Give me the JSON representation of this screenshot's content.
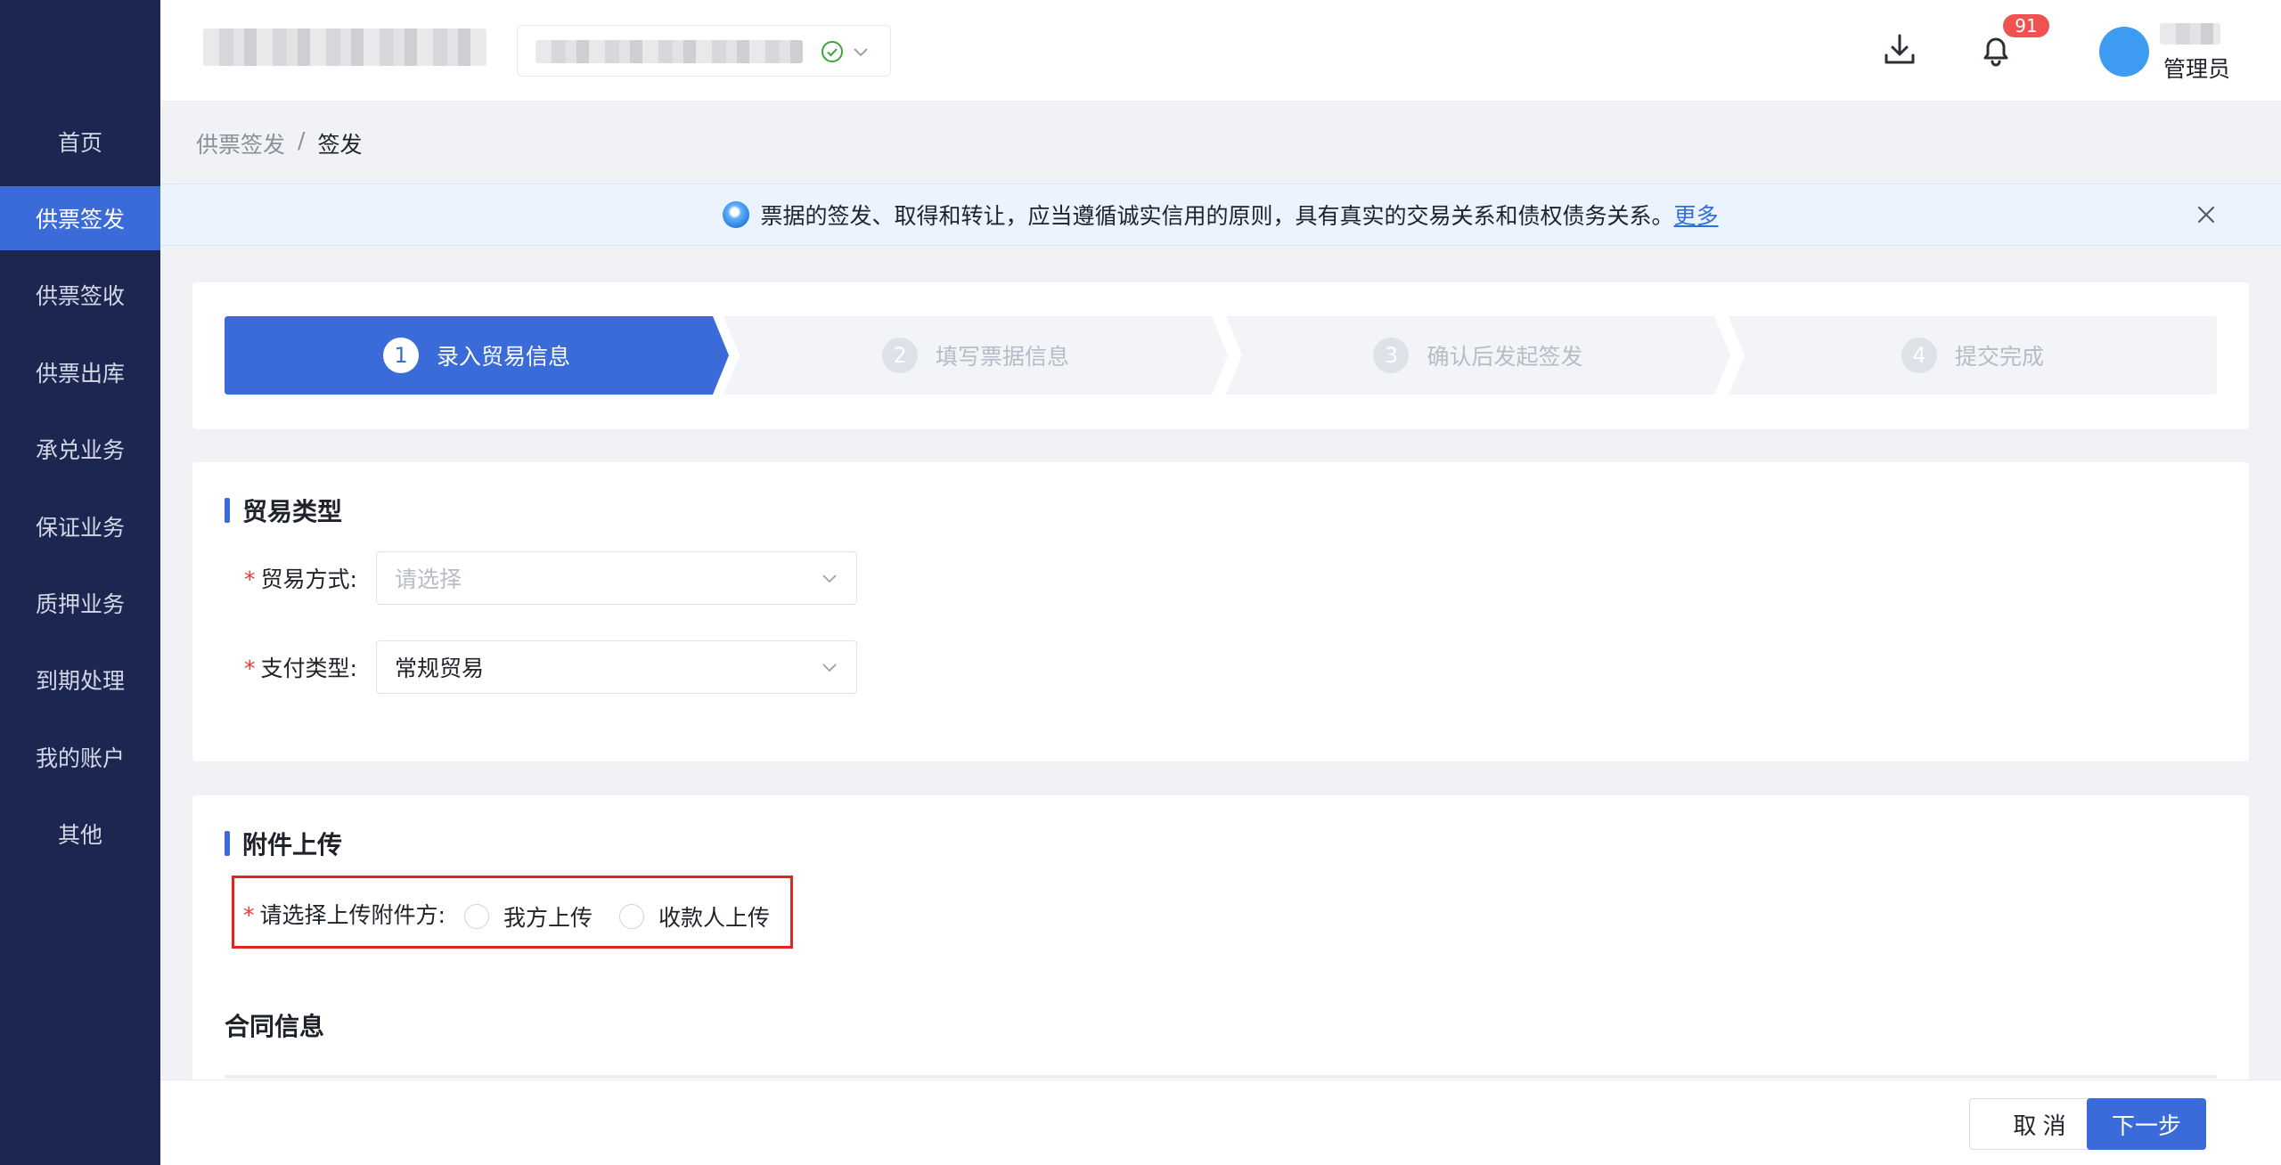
{
  "sidebar": {
    "items": [
      {
        "label": "首页",
        "active": false
      },
      {
        "label": "供票签发",
        "active": true
      },
      {
        "label": "供票签收",
        "active": false
      },
      {
        "label": "供票出库",
        "active": false
      },
      {
        "label": "承兑业务",
        "active": false
      },
      {
        "label": "保证业务",
        "active": false
      },
      {
        "label": "质押业务",
        "active": false
      },
      {
        "label": "到期处理",
        "active": false
      },
      {
        "label": "我的账户",
        "active": false
      },
      {
        "label": "其他",
        "active": false
      }
    ]
  },
  "header": {
    "notification_count": "91",
    "user_role": "管理员",
    "icons": [
      "download-icon",
      "bell-icon",
      "check-circle-icon",
      "chevron-down-icon"
    ]
  },
  "breadcrumb": {
    "parent": "供票签发",
    "separator": "/",
    "current": "签发"
  },
  "notice": {
    "text": "票据的签发、取得和转让，应当遵循诚实信用的原则，具有真实的交易关系和债权债务关系。",
    "link": "更多"
  },
  "steps": [
    {
      "num": "1",
      "label": "录入贸易信息",
      "active": true
    },
    {
      "num": "2",
      "label": "填写票据信息",
      "active": false
    },
    {
      "num": "3",
      "label": "确认后发起签发",
      "active": false
    },
    {
      "num": "4",
      "label": "提交完成",
      "active": false
    }
  ],
  "trade_section": {
    "title": "贸易类型",
    "trade_method_label": "贸易方式:",
    "trade_method_placeholder": "请选择",
    "payment_type_label": "支付类型:",
    "payment_type_value": "常规贸易",
    "required_mark": "*"
  },
  "attach_section": {
    "title": "附件上传",
    "uploader_label": "请选择上传附件方:",
    "option_self": "我方上传",
    "option_payee": "收款人上传",
    "contract_title": "合同信息"
  },
  "footer": {
    "cancel_label": "取 消",
    "next_label": "下一步"
  },
  "colors": {
    "sidebar_bg": "#1c2751",
    "accent": "#3a6bd8",
    "highlight_border": "#e3231d",
    "badge": "#f05252"
  }
}
